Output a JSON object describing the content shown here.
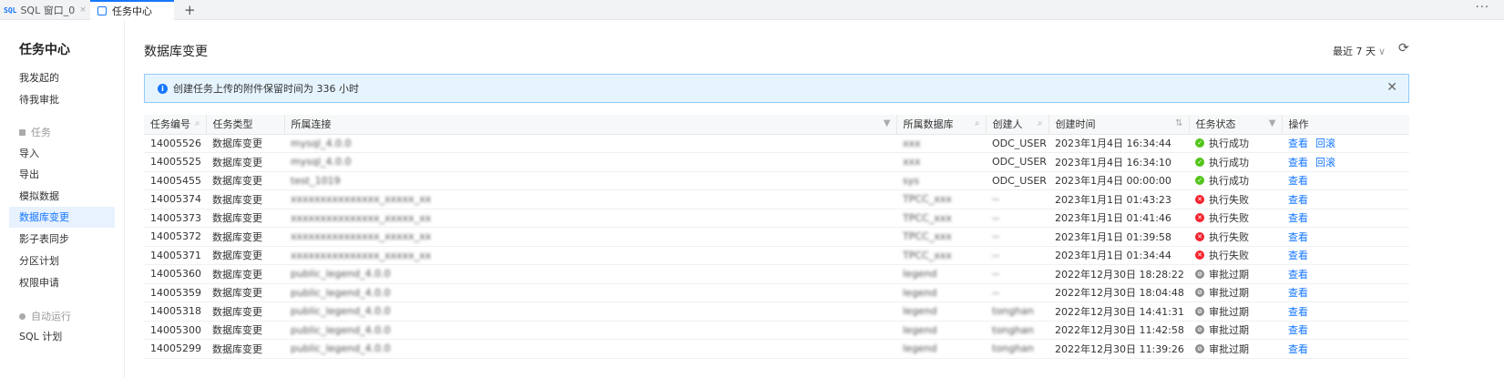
{
  "tabs": [
    {
      "icon": "SQL",
      "label": "SQL 窗口_0",
      "close": "×"
    },
    {
      "label": "任务中心"
    }
  ],
  "tab_add": "+",
  "tab_more": "···",
  "sidebar": {
    "title": "任务中心",
    "items_top": [
      "我发起的",
      "待我审批"
    ],
    "group_tasks": "任务",
    "task_items": [
      "导入",
      "导出",
      "模拟数据",
      "数据库变更",
      "影子表同步",
      "分区计划",
      "权限申请"
    ],
    "active": "数据库变更",
    "group_auto": "自动运行",
    "auto_items": [
      "SQL 计划"
    ]
  },
  "page": {
    "title": "数据库变更",
    "range": "最近 7 天",
    "notice": "创建任务上传的附件保留时间为 336 小时"
  },
  "columns": [
    "任务编号",
    "任务类型",
    "所属连接",
    "所属数据库",
    "创建人",
    "创建时间",
    "任务状态",
    "操作"
  ],
  "rows": [
    {
      "id": "14005526",
      "type": "数据库变更",
      "conn": "mysql_4.0.0",
      "db": "xxx",
      "creator": "ODC_USER",
      "time": "2023年1月4日 16:34:44",
      "status": "执行成功",
      "kind": "ok",
      "ops": [
        "查看",
        "回滚"
      ]
    },
    {
      "id": "14005525",
      "type": "数据库变更",
      "conn": "mysql_4.0.0",
      "db": "xxx",
      "creator": "ODC_USER",
      "time": "2023年1月4日 16:34:10",
      "status": "执行成功",
      "kind": "ok",
      "ops": [
        "查看",
        "回滚"
      ]
    },
    {
      "id": "14005455",
      "type": "数据库变更",
      "conn": "test_1019",
      "db": "sys",
      "creator": "ODC_USER",
      "time": "2023年1月4日 00:00:00",
      "status": "执行成功",
      "kind": "ok",
      "ops": [
        "查看"
      ]
    },
    {
      "id": "14005374",
      "type": "数据库变更",
      "conn": "xxxxxxxxxxxxxxx_xxxxx_xx",
      "db": "TPCC_xxx",
      "creator": "--",
      "time": "2023年1月1日 01:43:23",
      "status": "执行失败",
      "kind": "fail",
      "ops": [
        "查看"
      ]
    },
    {
      "id": "14005373",
      "type": "数据库变更",
      "conn": "xxxxxxxxxxxxxxx_xxxxx_xx",
      "db": "TPCC_xxx",
      "creator": "--",
      "time": "2023年1月1日 01:41:46",
      "status": "执行失败",
      "kind": "fail",
      "ops": [
        "查看"
      ]
    },
    {
      "id": "14005372",
      "type": "数据库变更",
      "conn": "xxxxxxxxxxxxxxx_xxxxx_xx",
      "db": "TPCC_xxx",
      "creator": "--",
      "time": "2023年1月1日 01:39:58",
      "status": "执行失败",
      "kind": "fail",
      "ops": [
        "查看"
      ]
    },
    {
      "id": "14005371",
      "type": "数据库变更",
      "conn": "xxxxxxxxxxxxxxx_xxxxx_xx",
      "db": "TPCC_xxx",
      "creator": "--",
      "time": "2023年1月1日 01:34:44",
      "status": "执行失败",
      "kind": "fail",
      "ops": [
        "查看"
      ]
    },
    {
      "id": "14005360",
      "type": "数据库变更",
      "conn": "public_legend_4.0.0",
      "db": "legend",
      "creator": "--",
      "time": "2022年12月30日 18:28:22",
      "status": "审批过期",
      "kind": "exp",
      "ops": [
        "查看"
      ]
    },
    {
      "id": "14005359",
      "type": "数据库变更",
      "conn": "public_legend_4.0.0",
      "db": "legend",
      "creator": "--",
      "time": "2022年12月30日 18:04:48",
      "status": "审批过期",
      "kind": "exp",
      "ops": [
        "查看"
      ]
    },
    {
      "id": "14005318",
      "type": "数据库变更",
      "conn": "public_legend_4.0.0",
      "db": "legend",
      "creator": "tonghan",
      "time": "2022年12月30日 14:41:31",
      "status": "审批过期",
      "kind": "exp",
      "ops": [
        "查看"
      ]
    },
    {
      "id": "14005300",
      "type": "数据库变更",
      "conn": "public_legend_4.0.0",
      "db": "legend",
      "creator": "tonghan",
      "time": "2022年12月30日 11:42:58",
      "status": "审批过期",
      "kind": "exp",
      "ops": [
        "查看"
      ]
    },
    {
      "id": "14005299",
      "type": "数据库变更",
      "conn": "public_legend_4.0.0",
      "db": "legend",
      "creator": "tonghan",
      "time": "2022年12月30日 11:39:26",
      "status": "审批过期",
      "kind": "exp",
      "ops": [
        "查看"
      ]
    }
  ],
  "colors": {
    "accent": "#1677ff",
    "success": "#52c41a",
    "fail": "#f5222d",
    "expired": "#8c8c8c"
  }
}
